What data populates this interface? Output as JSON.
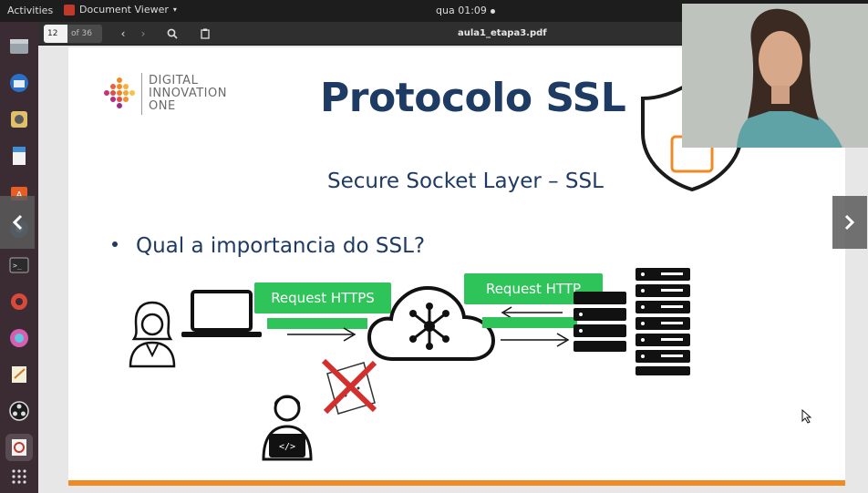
{
  "topbar": {
    "activities": "Activities",
    "app_name": "Document Viewer",
    "clock": "qua 01:09"
  },
  "viewer": {
    "current_page": "12",
    "page_total": "of 36",
    "filename": "aula1_etapa3.pdf"
  },
  "slide": {
    "logo_lines": [
      "DIGITAL",
      "INNOVATION",
      "ONE"
    ],
    "title": "Protocolo SSL",
    "subtitle": "Secure Socket Layer – SSL",
    "bullet": "Qual a importancia do SSL?",
    "labels": {
      "request_https": "Request HTTPS",
      "request_http": "Request HTTP"
    }
  },
  "colors": {
    "accent_green": "#2ec45a",
    "title_blue": "#1e3b63",
    "orange": "#f08a24",
    "red_cross": "#d32f2f"
  },
  "icons": [
    "app-icon",
    "prev-icon",
    "next-icon",
    "search-icon",
    "clipboard-icon",
    "person-icon",
    "laptop-icon",
    "cloud-network-icon",
    "server-icon",
    "hacker-icon",
    "blocked-icon",
    "shield-icon"
  ]
}
